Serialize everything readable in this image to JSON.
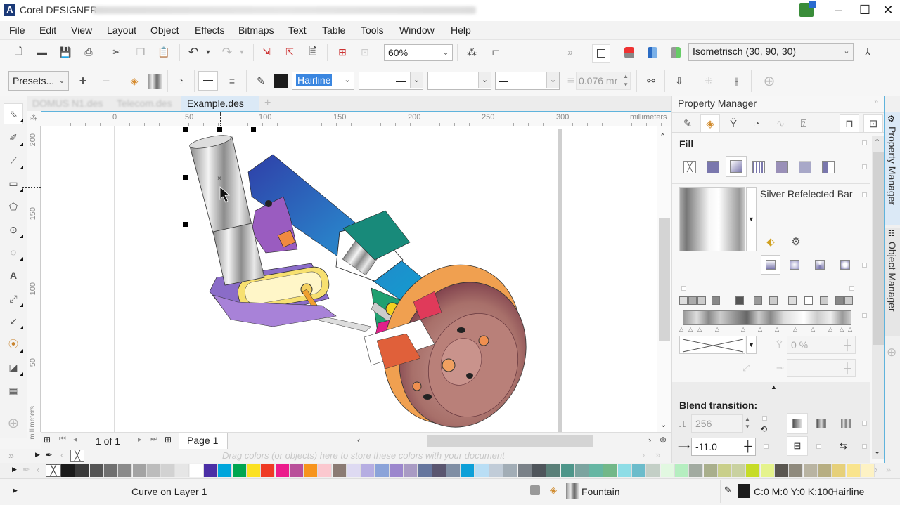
{
  "titlebar": {
    "app_name": "Corel DESIGNER",
    "blurred_path": "",
    "minimize": "–",
    "maximize": "☐",
    "close": "✕"
  },
  "menu": [
    "File",
    "Edit",
    "View",
    "Layout",
    "Object",
    "Effects",
    "Bitmaps",
    "Text",
    "Table",
    "Tools",
    "Window",
    "Help"
  ],
  "standard_toolbar": {
    "zoom_value": "60%",
    "projection_value": "Isometrisch (30, 90, 30)",
    "more": "»"
  },
  "property_bar": {
    "presets_label": "Presets...",
    "outline_width_value": "Hairline",
    "outline_size_value": "0.076 mr"
  },
  "document_tabs": [
    {
      "label": "DOMUS N1.des",
      "active": false,
      "blurred": true
    },
    {
      "label": "Telecom.des",
      "active": false,
      "blurred": true
    },
    {
      "label": "Example.des",
      "active": true,
      "blurred": false
    }
  ],
  "add_tab": "+",
  "horizontal_ruler": {
    "ticks": [
      "0",
      "50",
      "100",
      "150",
      "200",
      "250",
      "300"
    ],
    "unit": "millimeters"
  },
  "vertical_ruler": {
    "ticks": [
      "200",
      "150",
      "100",
      "50"
    ],
    "unit": "millimeters"
  },
  "page_navigator": {
    "page_count_label": "1 of 1",
    "page_tab": "Page 1"
  },
  "document_palette": {
    "hint": "Drag colors (or objects) here to store these colors with your document"
  },
  "color_palette": [
    "#1a1a1a",
    "#3a3a3a",
    "#555555",
    "#707070",
    "#8a8a8a",
    "#a3a3a3",
    "#bcbcbc",
    "#d2d2d2",
    "#e6e6e6",
    "#ffffff",
    "#4b2fa6",
    "#00a6dc",
    "#00a651",
    "#fbe122",
    "#ef3a24",
    "#ec1c8c",
    "#b9509a",
    "#f7941d",
    "#fbc8cf",
    "#8b7b74",
    "#dedaf2",
    "#b6aee2",
    "#8ba3d9",
    "#9c87cd",
    "#a99bc4",
    "#66769e",
    "#5a5670",
    "#7f8ea4",
    "#0ea0d8",
    "#b9def5",
    "#c1ccd8",
    "#a2adb6",
    "#7a8188",
    "#4f555b",
    "#5a7f78",
    "#4e968a",
    "#7ba49f",
    "#66b6a3",
    "#72b889",
    "#8edde6",
    "#6cbccb",
    "#c3cfc6",
    "#e2f8e1",
    "#b5eec0",
    "#a2aba1",
    "#a9af8c",
    "#c9cf8a",
    "#c9d1a0",
    "#c6dc27",
    "#e5f38c",
    "#5a5650",
    "#8f8a7d",
    "#b9b4a2",
    "#b7ae82",
    "#e6d07a",
    "#f9e48d",
    "#fdf2c4"
  ],
  "statusbar": {
    "object_info": "Curve on Layer 1",
    "fill_label": "Fountain",
    "outline_color": "C:0 M:0 Y:0 K:100",
    "outline_width": "Hairline"
  },
  "property_manager": {
    "title": "Property Manager",
    "fill_section": "Fill",
    "fill_name": "Silver Refelected Bar",
    "transparency_value": "0 %",
    "blend_section": "Blend transition:",
    "steps_value": "256",
    "acceleration_value": "-11.0"
  },
  "dock_tabs": [
    "Property Manager",
    "Object Manager"
  ]
}
